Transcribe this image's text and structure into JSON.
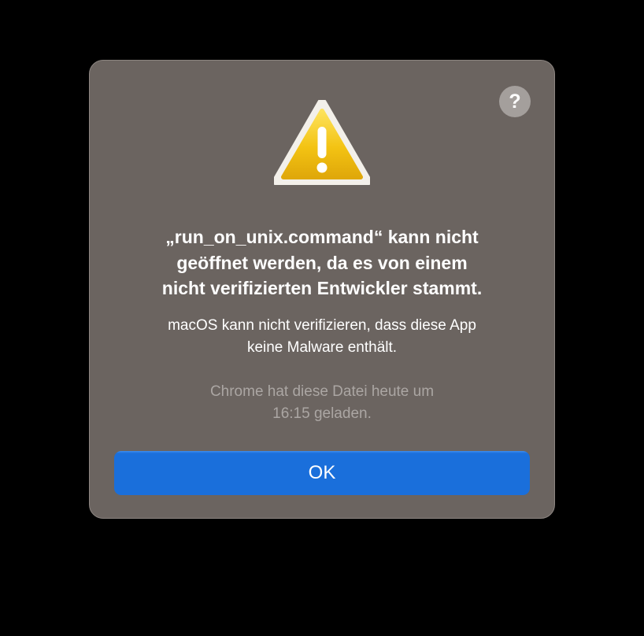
{
  "dialog": {
    "help_label": "?",
    "icon": "warning-triangle-icon",
    "title_lines": [
      "„run_on_unix.command“ kann nicht",
      "geöffnet werden, da es von einem",
      "nicht verifizierten Entwickler stammt."
    ],
    "message_lines": [
      "macOS kann nicht verifizieren, dass diese App",
      "keine Malware enthält."
    ],
    "note_lines": [
      "Chrome hat diese Datei heute um",
      "16:15 geladen."
    ],
    "ok_label": "OK"
  },
  "colors": {
    "background": "#000000",
    "dialog_background": "#6b6460",
    "accent": "#1a6fdb",
    "warning_yellow": "#f3c313"
  }
}
